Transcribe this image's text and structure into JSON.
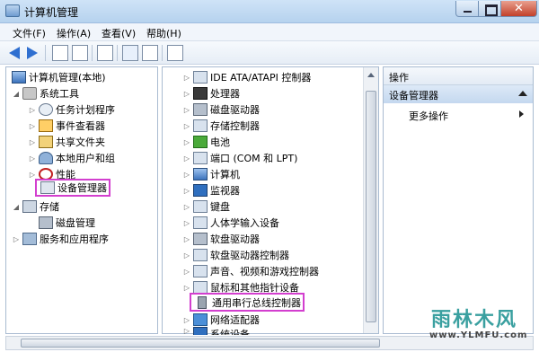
{
  "window": {
    "title": "计算机管理"
  },
  "menu": [
    "文件(F)",
    "操作(A)",
    "查看(V)",
    "帮助(H)"
  ],
  "left_tree": [
    {
      "label": "计算机管理(本地)",
      "icon": "computer-icon"
    },
    {
      "label": "系统工具",
      "icon": "tools-icon"
    },
    {
      "label": "任务计划程序",
      "icon": "clock-icon"
    },
    {
      "label": "事件查看器",
      "icon": "event-viewer-icon"
    },
    {
      "label": "共享文件夹",
      "icon": "shared-folder-icon"
    },
    {
      "label": "本地用户和组",
      "icon": "users-icon"
    },
    {
      "label": "性能",
      "icon": "performance-icon"
    },
    {
      "label": "设备管理器",
      "icon": "device-manager-icon"
    },
    {
      "label": "存储",
      "icon": "storage-icon"
    },
    {
      "label": "磁盘管理",
      "icon": "disk-icon"
    },
    {
      "label": "服务和应用程序",
      "icon": "services-icon"
    }
  ],
  "devices": [
    "IDE ATA/ATAPI 控制器",
    "处理器",
    "磁盘驱动器",
    "存储控制器",
    "电池",
    "端口 (COM 和 LPT)",
    "计算机",
    "监视器",
    "键盘",
    "人体学输入设备",
    "软盘驱动器",
    "软盘驱动器控制器",
    "声音、视频和游戏控制器",
    "鼠标和其他指针设备",
    "通用串行总线控制器",
    "网络适配器",
    "系统设备"
  ],
  "actions": {
    "header": "操作",
    "section": "设备管理器",
    "more": "更多操作"
  },
  "watermark": {
    "title": "雨林木风",
    "url": "www.YLMFU.com"
  }
}
